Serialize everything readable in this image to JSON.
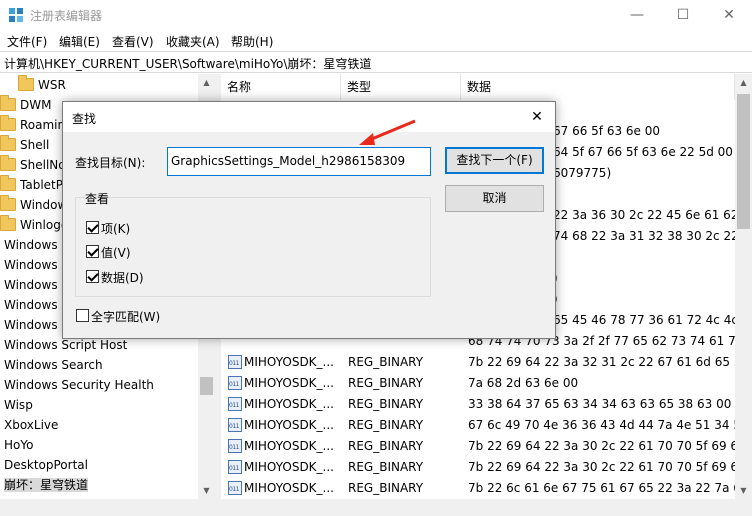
{
  "window": {
    "title": "注册表编辑器",
    "minimize_glyph": "—",
    "maximize_glyph": "☐",
    "close_glyph": "✕"
  },
  "menu": [
    "文件(F)",
    "编辑(E)",
    "查看(V)",
    "收藏夹(A)",
    "帮助(H)"
  ],
  "address": "计算机\\HKEY_CURRENT_USER\\Software\\miHoYo\\崩坏：星穹铁道",
  "tree": {
    "items": [
      {
        "label": "WSR",
        "folder": true
      },
      {
        "label": "DWM",
        "folder": true
      },
      {
        "label": "Roamin",
        "folder": true
      },
      {
        "label": "Shell",
        "folder": true
      },
      {
        "label": "ShellNo",
        "folder": true
      },
      {
        "label": "TabletP",
        "folder": true
      },
      {
        "label": "Window",
        "folder": true
      },
      {
        "label": "Winloge",
        "folder": true
      },
      {
        "label": "Windows",
        "folder": false
      },
      {
        "label": "Windows",
        "folder": false
      },
      {
        "label": "Windows",
        "folder": false
      },
      {
        "label": "Windows",
        "folder": false
      },
      {
        "label": "Windows",
        "folder": false
      },
      {
        "label": "Windows Script Host",
        "folder": false
      },
      {
        "label": "Windows Search",
        "folder": false
      },
      {
        "label": "Windows Security Health",
        "folder": false
      },
      {
        "label": "Wisp",
        "folder": false
      },
      {
        "label": "XboxLive",
        "folder": false
      },
      {
        "label": "HoYo",
        "folder": false
      },
      {
        "label": "DesktopPortal",
        "folder": false
      },
      {
        "label": "崩坏：星穹铁道",
        "folder": false,
        "selected": true
      }
    ]
  },
  "list": {
    "headers": [
      "名称",
      "类型",
      "数据"
    ],
    "partial_rows": [
      {
        "data": "67 66 5f 63 6e 00"
      },
      {
        "data": "64 5f 67 66 5f 63 6e 22 5d 00"
      },
      {
        "data": "6079775)"
      },
      {
        "data": "22 3a 36 30 2c 22 45 6e 61 62"
      },
      {
        "data": "74 68 22 3a 31 32 38 30 2c 22"
      },
      {
        "data": ")"
      },
      {
        "data": ")"
      },
      {
        "data": "65 45 46 78 77 36 61 72 4c 4c"
      },
      {
        "data": "68 74 74 70 73 3a 2f 2f 77 65 62 73 74 61 74"
      }
    ],
    "rows": [
      {
        "name": "MIHOYOSDK_...",
        "type": "REG_BINARY",
        "data": "7b 22 69 64 22 3a 32 31 2c 22 67 61 6d 65 5f"
      },
      {
        "name": "MIHOYOSDK_...",
        "type": "REG_BINARY",
        "data": "7a 68 2d 63 6e 00"
      },
      {
        "name": "MIHOYOSDK_...",
        "type": "REG_BINARY",
        "data": "33 38 64 37 65 63 34 34 63 63 65 38 63 00"
      },
      {
        "name": "MIHOYOSDK_...",
        "type": "REG_BINARY",
        "data": "67 6c 49 70 4e 36 36 43 4d 44 7a 4e 51 34 53"
      },
      {
        "name": "MIHOYOSDK_...",
        "type": "REG_BINARY",
        "data": "7b 22 69 64 22 3a 30 2c 22 61 70 70 5f 69 64"
      },
      {
        "name": "MIHOYOSDK_...",
        "type": "REG_BINARY",
        "data": "7b 22 69 64 22 3a 30 2c 22 61 70 70 5f 69 64"
      },
      {
        "name": "MIHOYOSDK_...",
        "type": "REG_BINARY",
        "data": "7b 22 6c 61 6e 67 75 61 67 65 22 3a 22 7a 68"
      }
    ]
  },
  "find_dialog": {
    "title": "查找",
    "target_label": "查找目标(N):",
    "target_value": "GraphicsSettings_Model_h2986158309",
    "find_next_label": "查找下一个(F)",
    "cancel_label": "取消",
    "group_title": "查看",
    "options": [
      {
        "label": "项(K)",
        "checked": true
      },
      {
        "label": "值(V)",
        "checked": true
      },
      {
        "label": "数据(D)",
        "checked": true
      }
    ],
    "whole_match_label": "全字匹配(W)",
    "whole_match_checked": false,
    "close_glyph": "✕"
  },
  "colors": {
    "accent": "#0078d7",
    "annotation_arrow": "#e8291c",
    "folder": "#f1c75b"
  }
}
